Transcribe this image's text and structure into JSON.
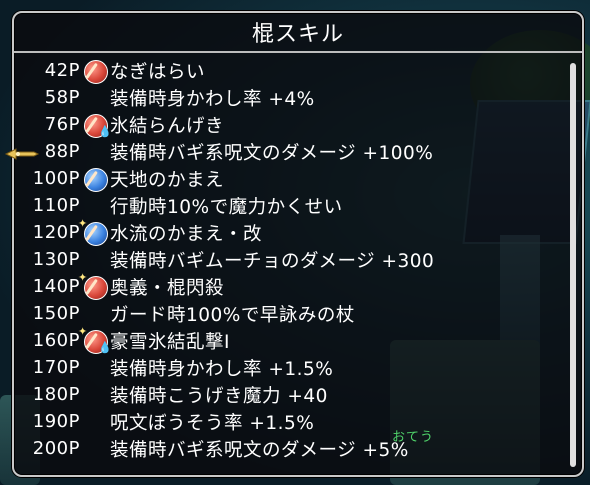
{
  "window": {
    "title": "棍スキル"
  },
  "skills": [
    {
      "points": "42P",
      "name": "なぎはらい",
      "icon": "red-orb-staff-icon",
      "highlighted": false
    },
    {
      "points": "58P",
      "name": "装備時身かわし率 +4%",
      "icon": "",
      "highlighted": false
    },
    {
      "points": "76P",
      "name": "氷結らんげき",
      "icon": "red-orb-staff-ice-icon",
      "highlighted": false
    },
    {
      "points": "88P",
      "name": "装備時バギ系呪文のダメージ +100%",
      "icon": "",
      "highlighted": true
    },
    {
      "points": "100P",
      "name": "天地のかまえ",
      "icon": "blue-orb-staff-icon",
      "highlighted": false
    },
    {
      "points": "110P",
      "name": "行動時10%で魔力かくせい",
      "icon": "",
      "highlighted": false
    },
    {
      "points": "120P",
      "name": "水流のかまえ・改",
      "icon": "blue-orb-staff-spark-icon",
      "highlighted": false
    },
    {
      "points": "130P",
      "name": "装備時バギムーチョのダメージ +300",
      "icon": "",
      "highlighted": false
    },
    {
      "points": "140P",
      "name": "奥義・棍閃殺",
      "icon": "red-orb-staff-spark-icon",
      "highlighted": false
    },
    {
      "points": "150P",
      "name": "ガード時100%で早詠みの杖",
      "icon": "",
      "highlighted": false
    },
    {
      "points": "160P",
      "name": "豪雪氷結乱撃Ⅰ",
      "icon": "red-orb-staff-ice-spark-icon",
      "highlighted": false
    },
    {
      "points": "170P",
      "name": "装備時身かわし率 +1.5%",
      "icon": "",
      "highlighted": false
    },
    {
      "points": "180P",
      "name": "装備時こうげき魔力 +40",
      "icon": "",
      "highlighted": false
    },
    {
      "points": "190P",
      "name": "呪文ぼうそう率 +1.5%",
      "icon": "",
      "highlighted": false
    },
    {
      "points": "200P",
      "name": "装備時バギ系呪文のダメージ +5%",
      "icon": "",
      "highlighted": false
    }
  ],
  "overlay": {
    "npc_label": "おてう"
  },
  "colors": {
    "text": "#ffffff",
    "npc_label": "#4fd26a",
    "window_border": "#c9c9c9"
  }
}
